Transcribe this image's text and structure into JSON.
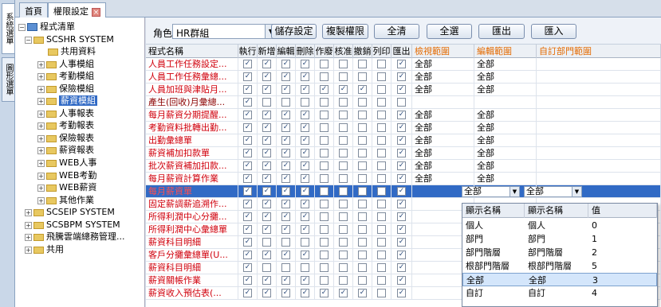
{
  "side_tabs": [
    "系統選單",
    "圖形選單"
  ],
  "tabs": [
    {
      "label": "首頁"
    },
    {
      "label": "權限設定"
    }
  ],
  "tree": {
    "root": "程式清單",
    "nodes": [
      "SCSHR SYSTEM",
      "共用資料",
      "人事模組",
      "考勤模組",
      "保險模組",
      "薪資模組",
      "人事報表",
      "考勤報表",
      "保險報表",
      "薪資報表",
      "WEB人事",
      "WEB考勤",
      "WEB薪資",
      "其他作業",
      "SCSEIP SYSTEM",
      "SCSBPM SYSTEM",
      "飛騰雲端總務管理...",
      "共用"
    ]
  },
  "toolbar": {
    "role_label": "角色",
    "role_value": "HR群組",
    "buttons": [
      "儲存設定",
      "複製權限",
      "全清",
      "全選",
      "匯出",
      "匯入"
    ]
  },
  "grid": {
    "headers": [
      "程式名稱",
      "執行",
      "新增",
      "編輯",
      "刪除",
      "作廢",
      "核准",
      "撤銷",
      "列印",
      "匯出",
      "檢視範圍",
      "編輯範圍",
      "自訂部門範圍"
    ],
    "rows": [
      {
        "name": "人員工作任務設定...",
        "checks": [
          1,
          1,
          1,
          1,
          0,
          0,
          0,
          0,
          1
        ],
        "view": "全部",
        "edit": "全部"
      },
      {
        "name": "人員工作任務彙總...",
        "checks": [
          1,
          1,
          1,
          1,
          0,
          0,
          0,
          0,
          1
        ],
        "view": "全部",
        "edit": "全部"
      },
      {
        "name": "人員加班與津貼月...",
        "checks": [
          1,
          1,
          1,
          1,
          1,
          1,
          1,
          0,
          1
        ],
        "view": "全部",
        "edit": "全部"
      },
      {
        "name": "產生(回收)月彙總...",
        "checks": [
          1,
          0,
          0,
          0,
          0,
          0,
          0,
          0,
          0
        ],
        "view": "",
        "edit": ""
      },
      {
        "name": "每月薪資分期提醒...",
        "checks": [
          1,
          1,
          1,
          1,
          0,
          0,
          0,
          0,
          1
        ],
        "view": "全部",
        "edit": "全部"
      },
      {
        "name": "考勤資料批轉出勤...",
        "checks": [
          1,
          1,
          1,
          1,
          0,
          0,
          0,
          0,
          1
        ],
        "view": "全部",
        "edit": "全部"
      },
      {
        "name": "出勤彙總單",
        "checks": [
          1,
          1,
          1,
          1,
          0,
          0,
          0,
          0,
          1
        ],
        "view": "全部",
        "edit": "全部"
      },
      {
        "name": "薪資補加扣款單",
        "checks": [
          1,
          1,
          1,
          1,
          0,
          0,
          0,
          0,
          1
        ],
        "view": "全部",
        "edit": "全部"
      },
      {
        "name": "批次薪資補加扣款...",
        "checks": [
          1,
          1,
          1,
          1,
          0,
          0,
          0,
          0,
          1
        ],
        "view": "全部",
        "edit": "全部"
      },
      {
        "name": "每月薪資計算作業",
        "checks": [
          1,
          1,
          1,
          1,
          0,
          0,
          0,
          0,
          1
        ],
        "view": "全部",
        "edit": "全部"
      },
      {
        "name": "每月薪資單",
        "checks": [
          1,
          1,
          1,
          1,
          0,
          0,
          0,
          0,
          1
        ],
        "view": "全部",
        "edit": "全部"
      },
      {
        "name": "固定薪調薪追溯作...",
        "checks": [
          1,
          1,
          1,
          1,
          0,
          0,
          0,
          0,
          1
        ],
        "view": "",
        "edit": ""
      },
      {
        "name": "所得利潤中心分攤...",
        "checks": [
          1,
          1,
          1,
          1,
          0,
          0,
          0,
          0,
          1
        ],
        "view": "",
        "edit": ""
      },
      {
        "name": "所得利潤中心彙總單",
        "checks": [
          1,
          1,
          1,
          1,
          0,
          0,
          0,
          0,
          1
        ],
        "view": "",
        "edit": ""
      },
      {
        "name": "薪資科目明細",
        "checks": [
          1,
          0,
          0,
          0,
          0,
          0,
          0,
          0,
          1
        ],
        "view": "",
        "edit": ""
      },
      {
        "name": "客戶分攤彙總單(U...",
        "checks": [
          1,
          1,
          1,
          1,
          0,
          0,
          0,
          0,
          1
        ],
        "view": "",
        "edit": ""
      },
      {
        "name": "薪資科目明細",
        "checks": [
          1,
          0,
          0,
          0,
          0,
          0,
          0,
          0,
          1
        ],
        "view": "",
        "edit": ""
      },
      {
        "name": "薪資關帳作業",
        "checks": [
          1,
          1,
          1,
          1,
          0,
          0,
          0,
          0,
          1
        ],
        "view": "",
        "edit": ""
      },
      {
        "name": "薪資收入預估表(...",
        "checks": [
          1,
          1,
          1,
          1,
          1,
          1,
          1,
          0,
          1
        ],
        "view": "",
        "edit": ""
      }
    ]
  },
  "popup": {
    "headers": [
      "顯示名稱",
      "顯示名稱",
      "值"
    ],
    "rows": [
      [
        "個人",
        "個人",
        "0"
      ],
      [
        "部門",
        "部門",
        "1"
      ],
      [
        "部門階層",
        "部門階層",
        "2"
      ],
      [
        "根部門階層",
        "根部門階層",
        "5"
      ],
      [
        "全部",
        "全部",
        "3"
      ],
      [
        "自訂",
        "自訂",
        "4"
      ]
    ],
    "selected_index": 4
  },
  "colors": {
    "selection": "#316ac5",
    "name_red": "#d0000c",
    "header_orange": "#e46a00"
  }
}
